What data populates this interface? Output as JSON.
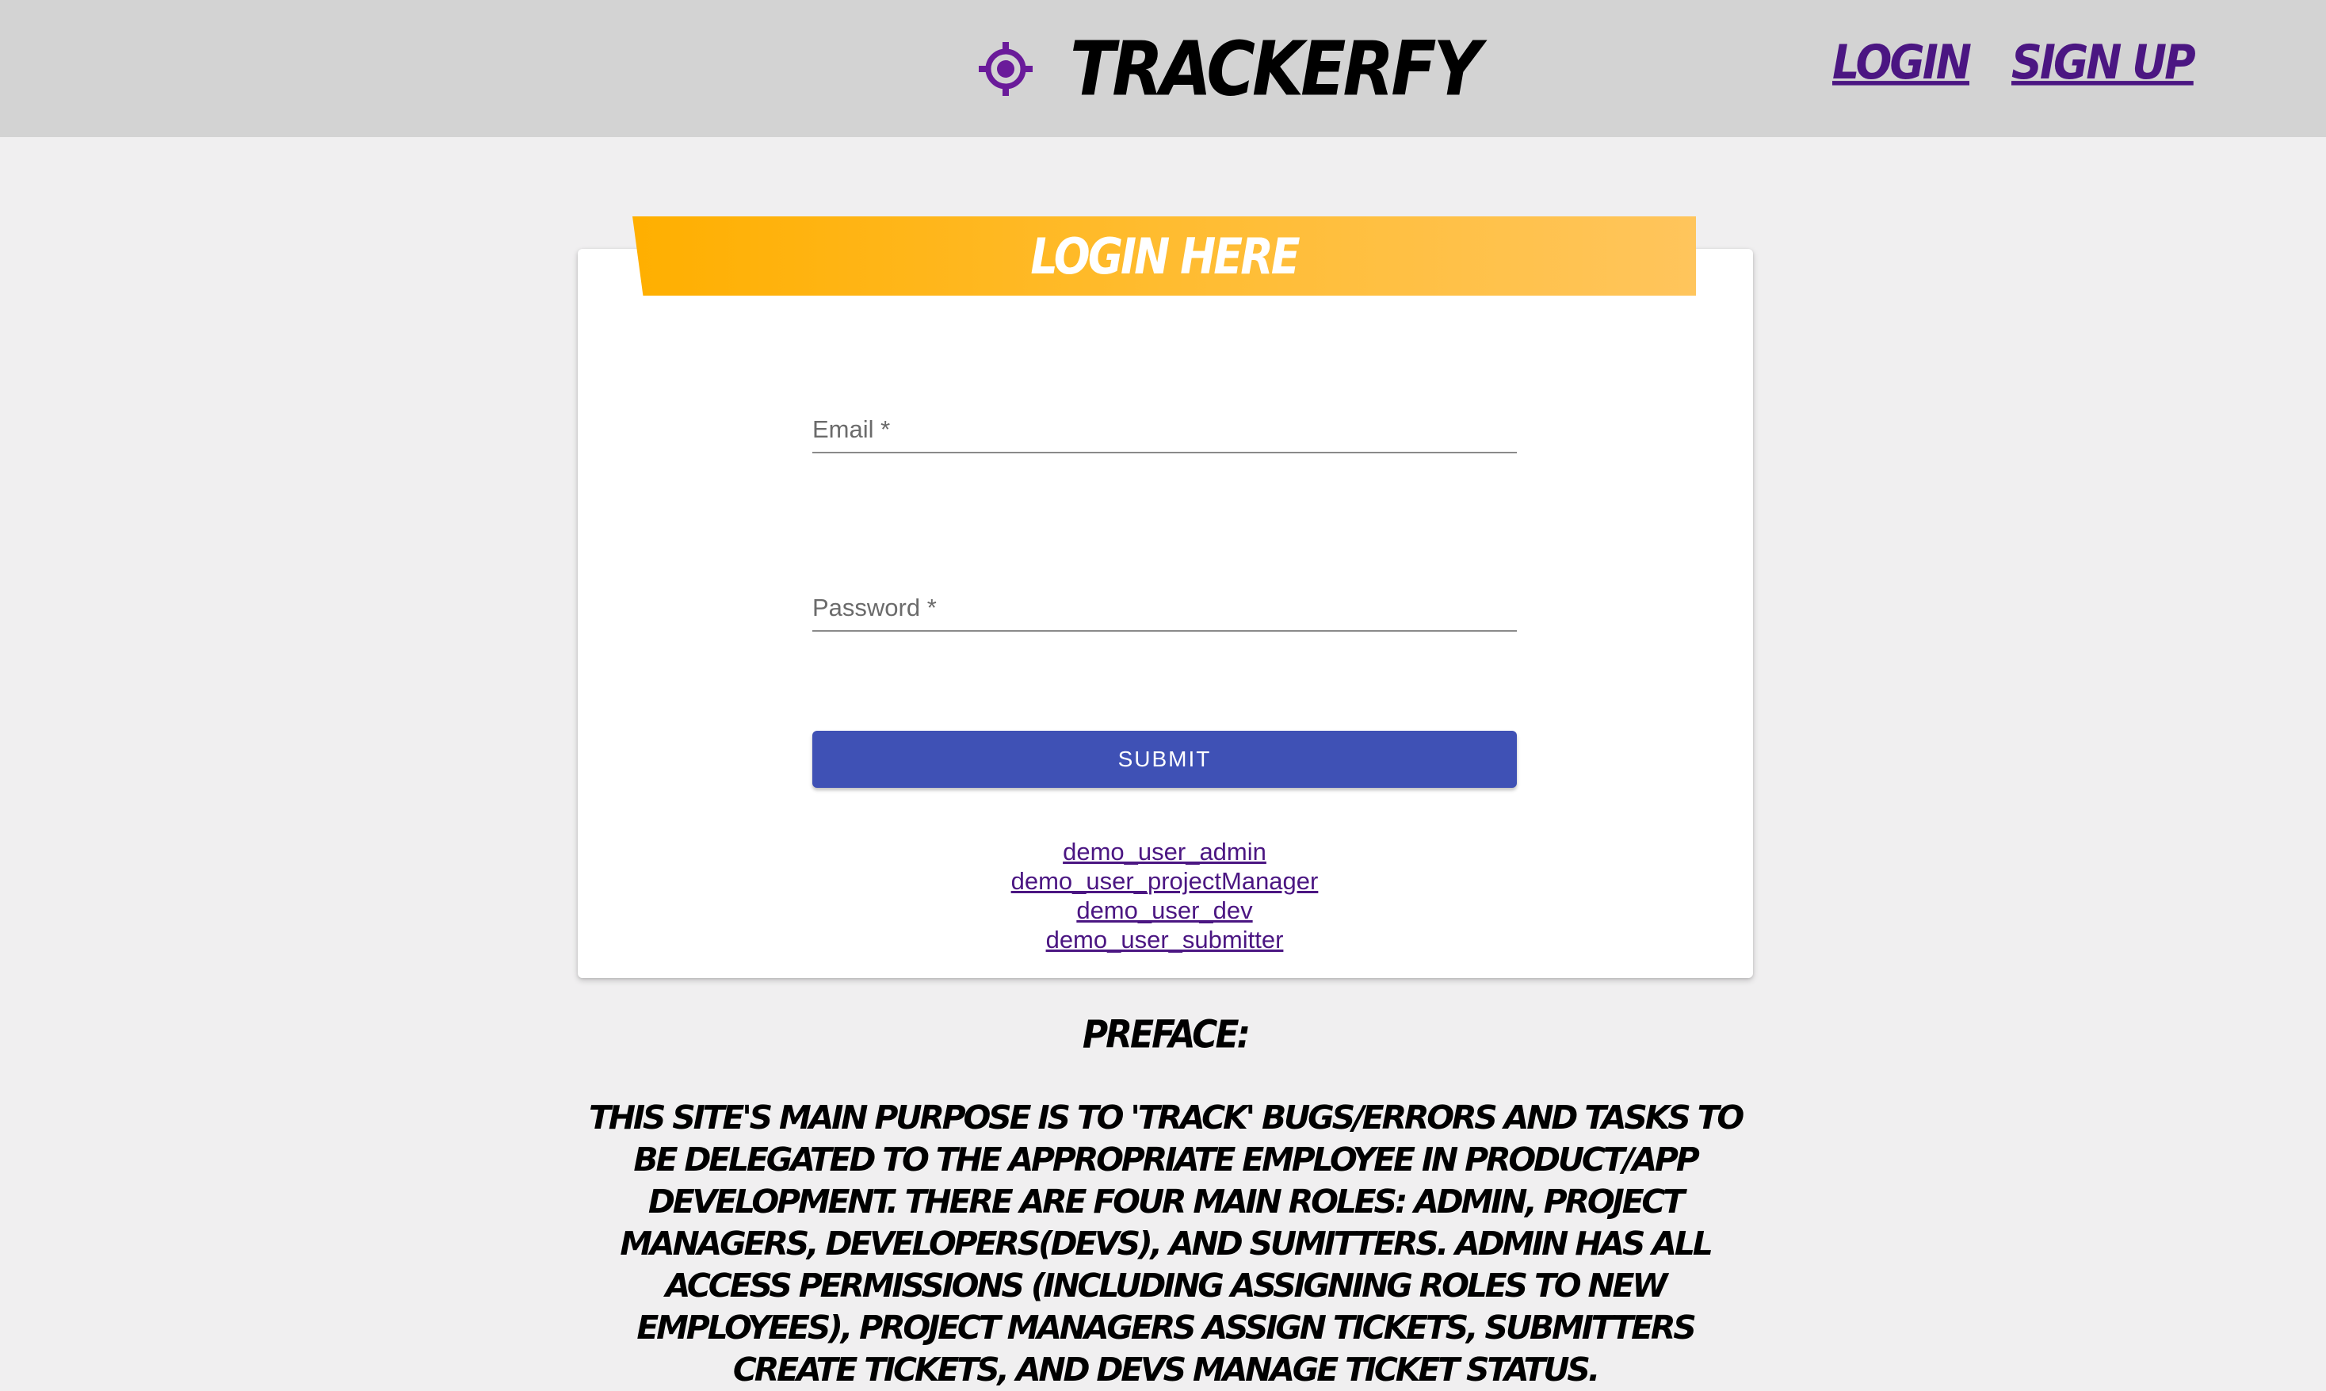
{
  "header": {
    "brand_icon": "crosshair-target-icon",
    "brand_name": "Trackerfy",
    "nav": {
      "login_label": "Login",
      "signup_label": "Sign up"
    }
  },
  "login_card": {
    "banner_title": "Login Here",
    "email_label": "Email *",
    "password_label": "Password *",
    "submit_label": "SUBMIT",
    "demo_users": {
      "admin": "demo_user_admin",
      "project_manager": "demo_user_projectManager",
      "dev": "demo_user_dev",
      "submitter": "demo_user_submitter"
    }
  },
  "preface": {
    "heading": "Preface:",
    "body": "This site's main purpose is to 'track' bugs/errors and tasks to be delegated to the appropriate employee in product/app development. There are four main roles: Admin, Project Managers, Developers(Devs), and Sumitters. Admin has all access permissions (including assigning roles to new employees), Project Managers assign tickets, Submitters create tickets, and Devs manage ticket status."
  },
  "colors": {
    "header_bg": "#d3d3d3",
    "page_bg": "#f0eff0",
    "brand_purple": "#4b1682",
    "icon_purple": "#6a1b9a",
    "banner_orange": "#ffaf00",
    "submit_blue": "#3f51b5"
  }
}
